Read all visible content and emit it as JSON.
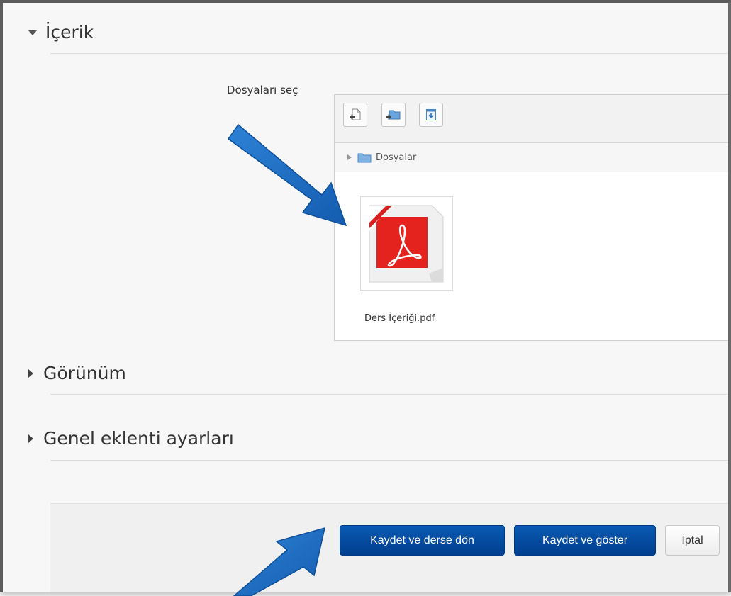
{
  "sections": {
    "content_title": "İçerik",
    "appearance_title": "Görünüm",
    "common_settings_title": "Genel eklenti ayarları"
  },
  "file_picker": {
    "label": "Dosyaları seç",
    "toolbar": [
      "add-file-icon",
      "create-folder-icon",
      "download-all-icon"
    ],
    "breadcrumb": "Dosyalar",
    "files": [
      {
        "name": "Ders İçeriği.pdf",
        "icon": "pdf-file-icon"
      }
    ]
  },
  "actions": {
    "save_return": "Kaydet ve derse dön",
    "save_display": "Kaydet ve göster",
    "cancel": "İptal"
  },
  "colors": {
    "primary_button": "#0a5ab3",
    "annotation_arrow": "#1f6fc8",
    "pdf_red": "#e02020"
  }
}
